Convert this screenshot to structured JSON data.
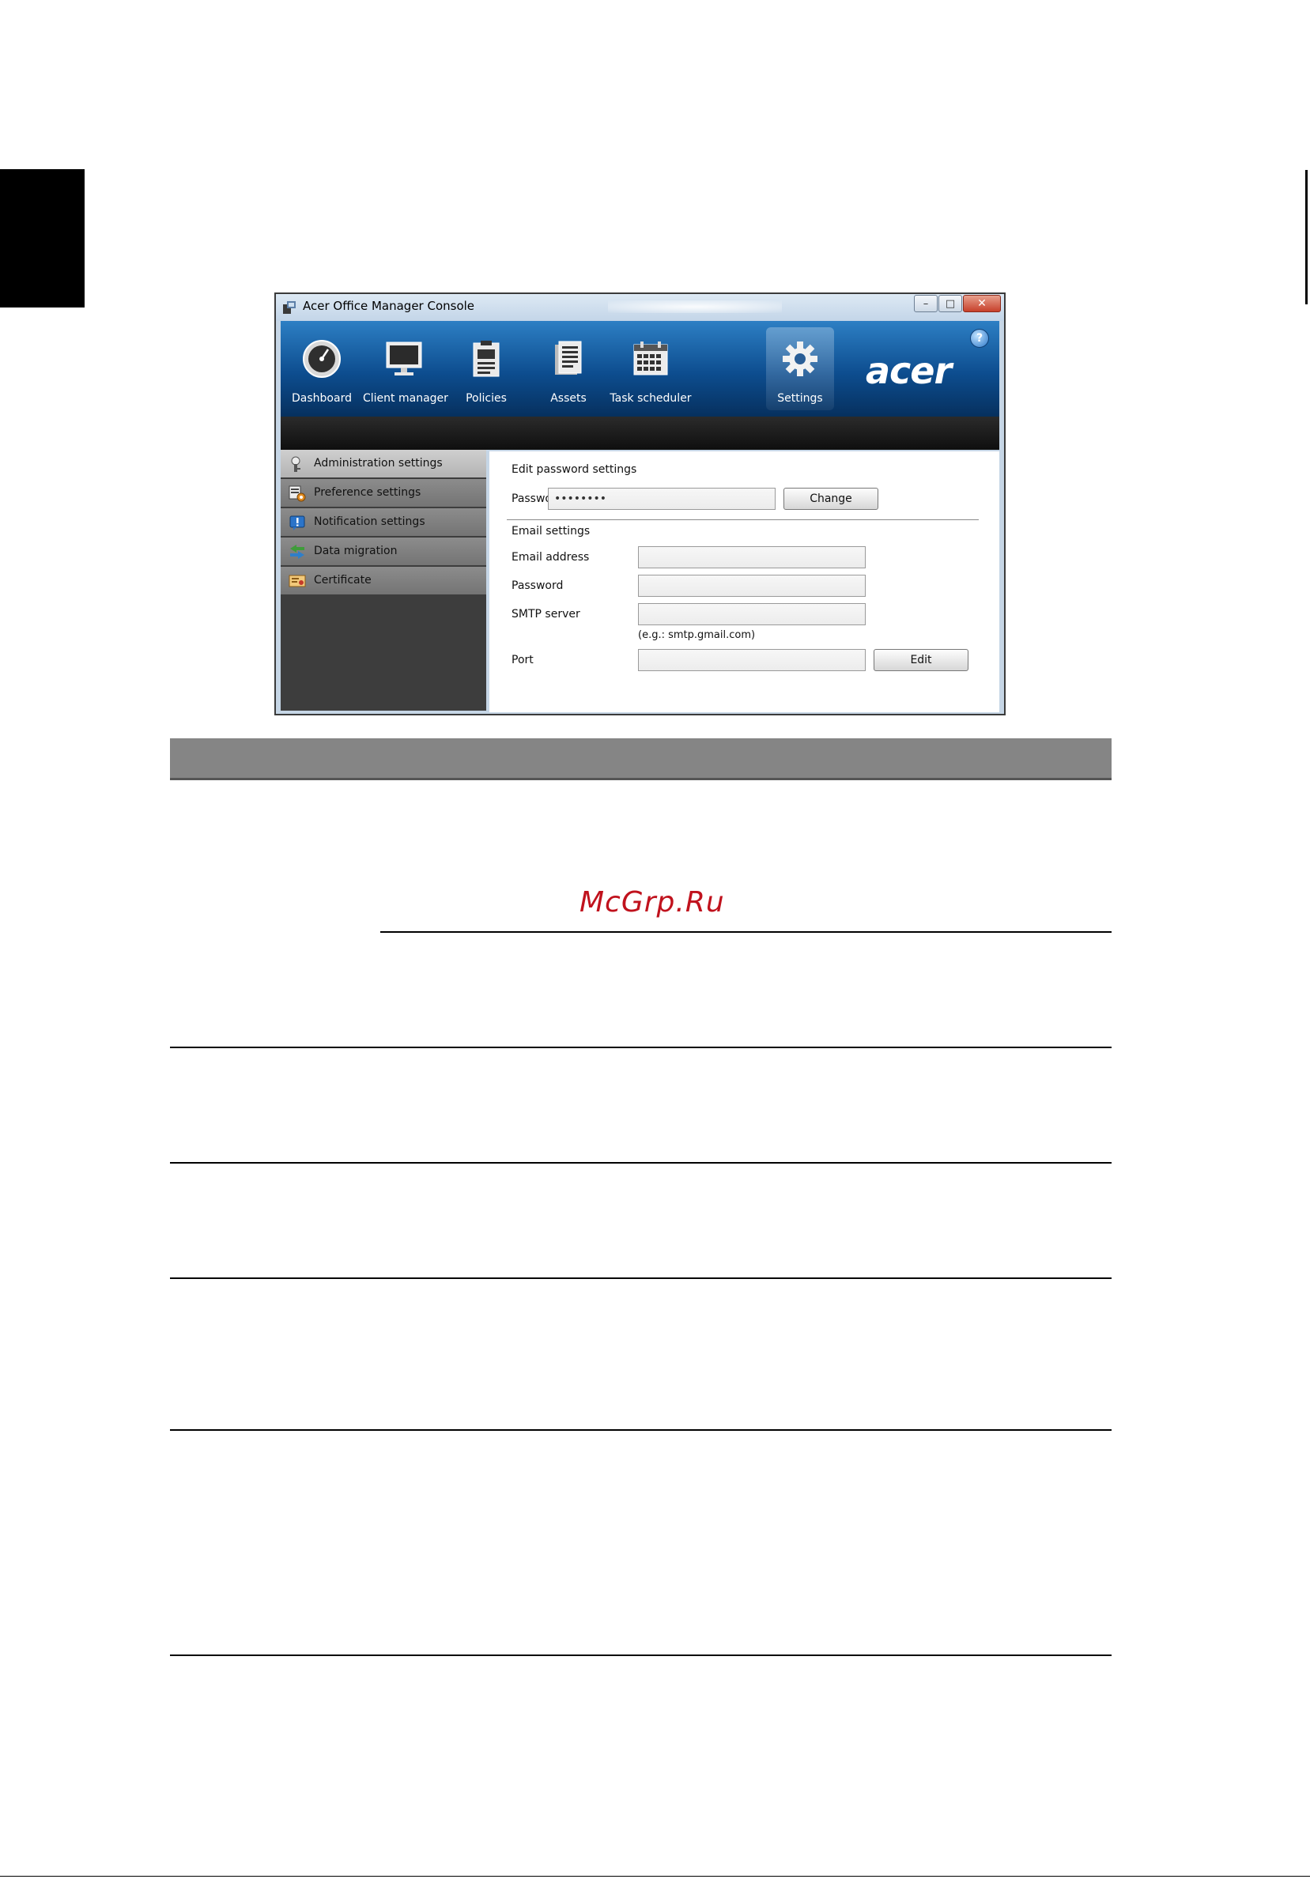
{
  "window": {
    "title": "Acer Office Manager Console",
    "controls": {
      "minimize": "–",
      "maximize": "□",
      "close": "✕"
    }
  },
  "nav": {
    "items": [
      {
        "label": "Dashboard",
        "icon": "dashboard-gauge-icon"
      },
      {
        "label": "Client manager",
        "icon": "monitor-icon"
      },
      {
        "label": "Policies",
        "icon": "clipboard-icon"
      },
      {
        "label": "Assets",
        "icon": "document-list-icon"
      },
      {
        "label": "Task scheduler",
        "icon": "calendar-icon"
      },
      {
        "label": "Settings",
        "icon": "gear-icon",
        "active": true
      }
    ],
    "logo": "acer",
    "help": "?"
  },
  "sidebar": {
    "items": [
      {
        "label": "Administration settings",
        "icon": "admin-key-icon",
        "active": true
      },
      {
        "label": "Preference settings",
        "icon": "preference-gear-icon"
      },
      {
        "label": "Notification settings",
        "icon": "notification-icon"
      },
      {
        "label": "Data migration",
        "icon": "migration-arrows-icon"
      },
      {
        "label": "Certificate",
        "icon": "certificate-icon"
      }
    ]
  },
  "content": {
    "password_section": {
      "heading": "Edit password settings",
      "password_label": "Password",
      "password_value": "••••••••",
      "change_button": "Change"
    },
    "email_section": {
      "heading": "Email settings",
      "email_label": "Email address",
      "email_value": "",
      "password_label": "Password",
      "password_value": "",
      "smtp_label": "SMTP server",
      "smtp_value": "",
      "smtp_hint": "(e.g.: smtp.gmail.com)",
      "port_label": "Port",
      "port_value": "",
      "edit_button": "Edit"
    }
  },
  "watermark": "McGrp.Ru",
  "colors": {
    "nav_blue": "#0d4d8f",
    "sidebar_dark": "#3d3d3d",
    "table_header": "#858585",
    "watermark_red": "#c0121d"
  }
}
